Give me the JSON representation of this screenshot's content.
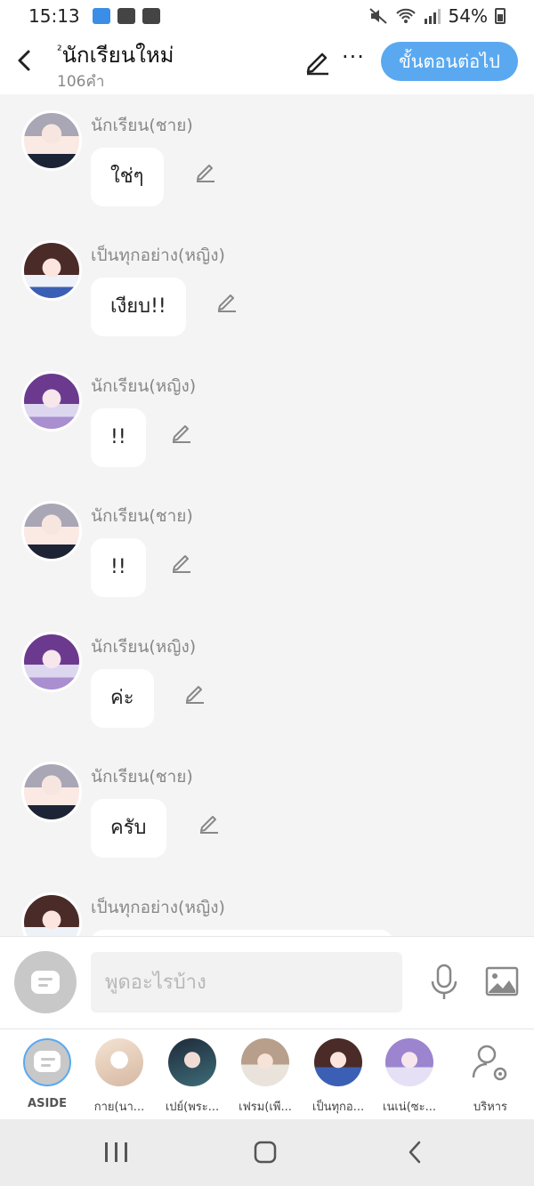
{
  "status_bar": {
    "time": "15:13",
    "battery": "54%"
  },
  "header": {
    "title": "นักเรียนใหม่",
    "title_prefix": "²",
    "subtitle": "106คำ",
    "next_label": "ขั้นตอนต่อไป",
    "more_label": "···"
  },
  "messages": [
    {
      "speaker": "นักเรียน(ชาย)",
      "text": "ใช่ๆ"
    },
    {
      "speaker": "เป็นทุกอย่าง(หญิง)",
      "text": "เงียบ!!"
    },
    {
      "speaker": "นักเรียน(หญิง)",
      "text": "!!"
    },
    {
      "speaker": "นักเรียน(ชาย)",
      "text": "!!"
    },
    {
      "speaker": "นักเรียน(หญิง)",
      "text": "ค่ะ"
    },
    {
      "speaker": "นักเรียน(ชาย)",
      "text": "ครับ"
    },
    {
      "speaker": "เป็นทุกอย่าง(หญิง)",
      "text": ""
    }
  ],
  "input": {
    "placeholder": "พูดอะไรบ้าง"
  },
  "characters": [
    {
      "label": "ASIDE"
    },
    {
      "label": "กาย(นา..."
    },
    {
      "label": "เปย์(พระ..."
    },
    {
      "label": "เฟรม(เพี..."
    },
    {
      "label": "เป็นทุกอ..."
    },
    {
      "label": "เนเน่(ซะ..."
    },
    {
      "label": "บริหาร"
    }
  ],
  "colors": {
    "accent": "#5aa9f0",
    "background": "#f4f4f4"
  }
}
